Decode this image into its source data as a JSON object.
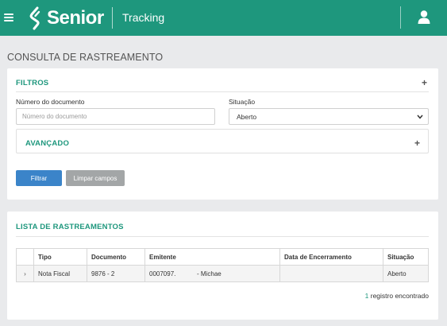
{
  "header": {
    "brand": "Senior",
    "app_name": "Tracking",
    "icons": {
      "menu": "hamburger-menu-icon",
      "logo": "senior-logo-icon",
      "user": "user-icon"
    }
  },
  "page": {
    "title": "CONSULTA DE RASTREAMENTO"
  },
  "filters": {
    "title": "FILTROS",
    "document": {
      "label": "Número do documento",
      "placeholder": "Número do documento",
      "value": ""
    },
    "status": {
      "label": "Situação",
      "value": "Aberto"
    },
    "advanced": {
      "title": "AVANÇADO"
    },
    "filter_button": "Filtrar",
    "clear_button": "Limpar campos"
  },
  "list": {
    "title": "LISTA DE RASTREAMENTOS",
    "columns": [
      "Tipo",
      "Documento",
      "Emitente",
      "Data de Encerramento",
      "Situação"
    ],
    "rows": [
      {
        "expander": "›",
        "tipo": "Nota Fiscal",
        "documento": "9876 - 2",
        "emitente": "0007097.            - Michae",
        "data_encerramento": "",
        "situacao": "Aberto"
      }
    ],
    "count_number": "1",
    "count_suffix": " registro encontrado"
  },
  "colors": {
    "brand": "#1e977d",
    "primary_button": "#3b84c9",
    "secondary_button": "#a3a6a7",
    "background": "#e9eaec"
  }
}
